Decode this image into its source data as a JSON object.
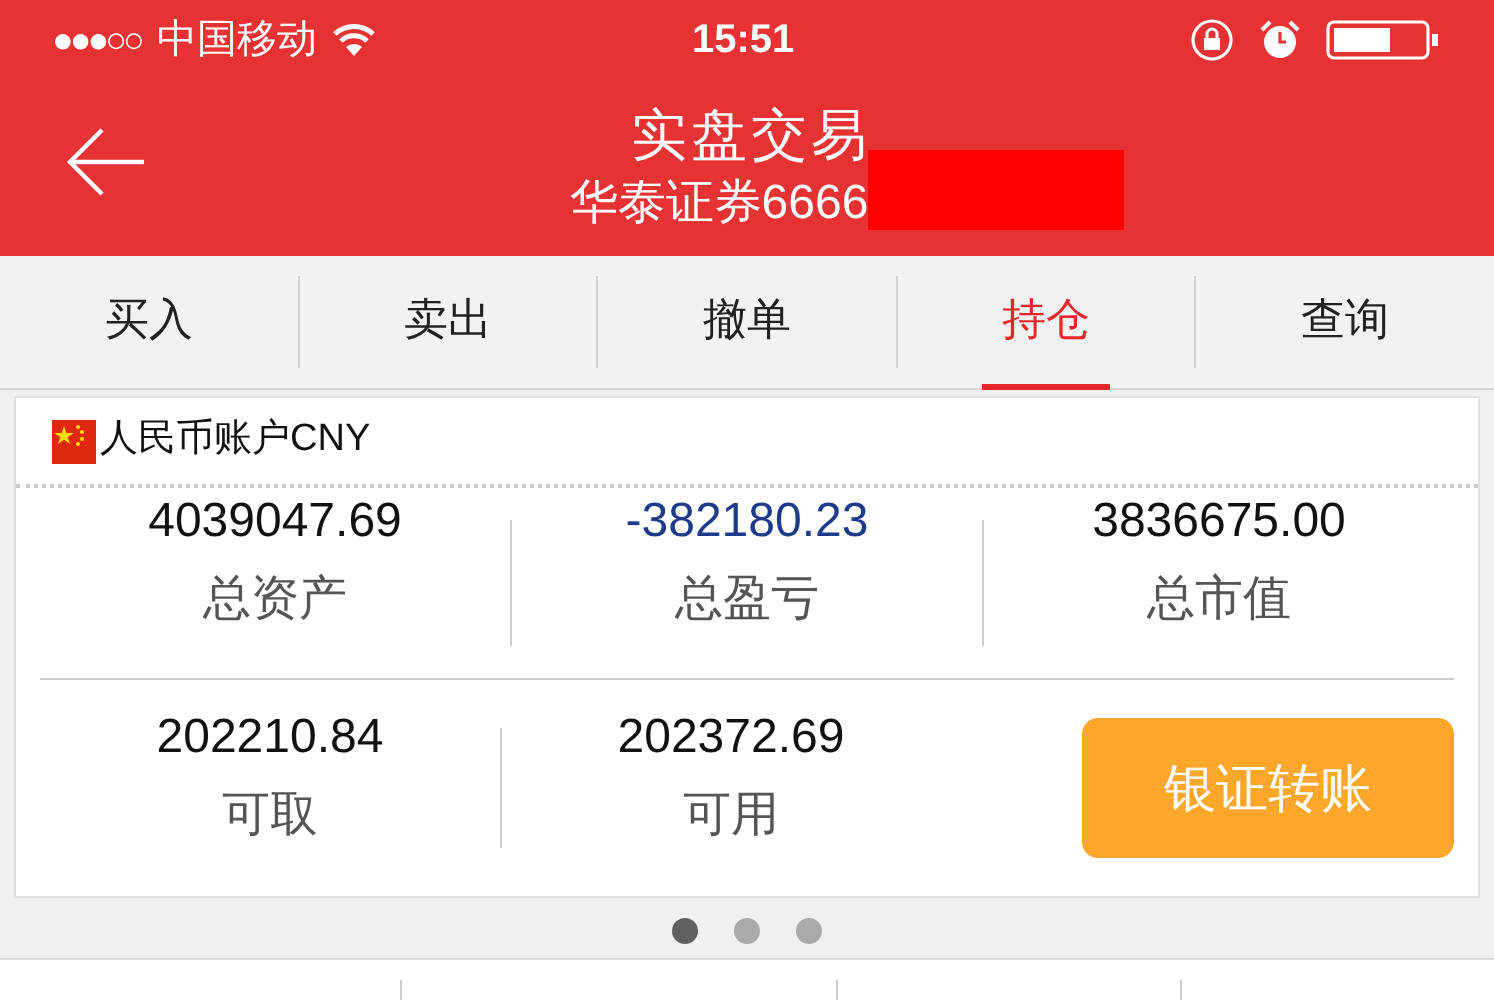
{
  "status_bar": {
    "signal": "●●●○○",
    "carrier": "中国移动",
    "time": "15:51"
  },
  "nav": {
    "title": "实盘交易",
    "subtitle": "华泰证券6666"
  },
  "tabs": [
    {
      "label": "买入",
      "selected": false
    },
    {
      "label": "卖出",
      "selected": false
    },
    {
      "label": "撤单",
      "selected": false
    },
    {
      "label": "持仓",
      "selected": true
    },
    {
      "label": "查询",
      "selected": false
    }
  ],
  "account": {
    "name": "人民币账户CNY",
    "stats": [
      {
        "value": "4039047.69",
        "label": "总资产",
        "kind": "plain"
      },
      {
        "value": "-382180.23",
        "label": "总盈亏",
        "kind": "loss"
      },
      {
        "value": "3836675.00",
        "label": "总市值",
        "kind": "plain"
      }
    ],
    "funds": [
      {
        "value": "202210.84",
        "label": "可取"
      },
      {
        "value": "202372.69",
        "label": "可用"
      }
    ],
    "transfer_button": "银证转账"
  },
  "pager": [
    {
      "selected": true
    },
    {
      "selected": false
    },
    {
      "selected": false
    }
  ]
}
